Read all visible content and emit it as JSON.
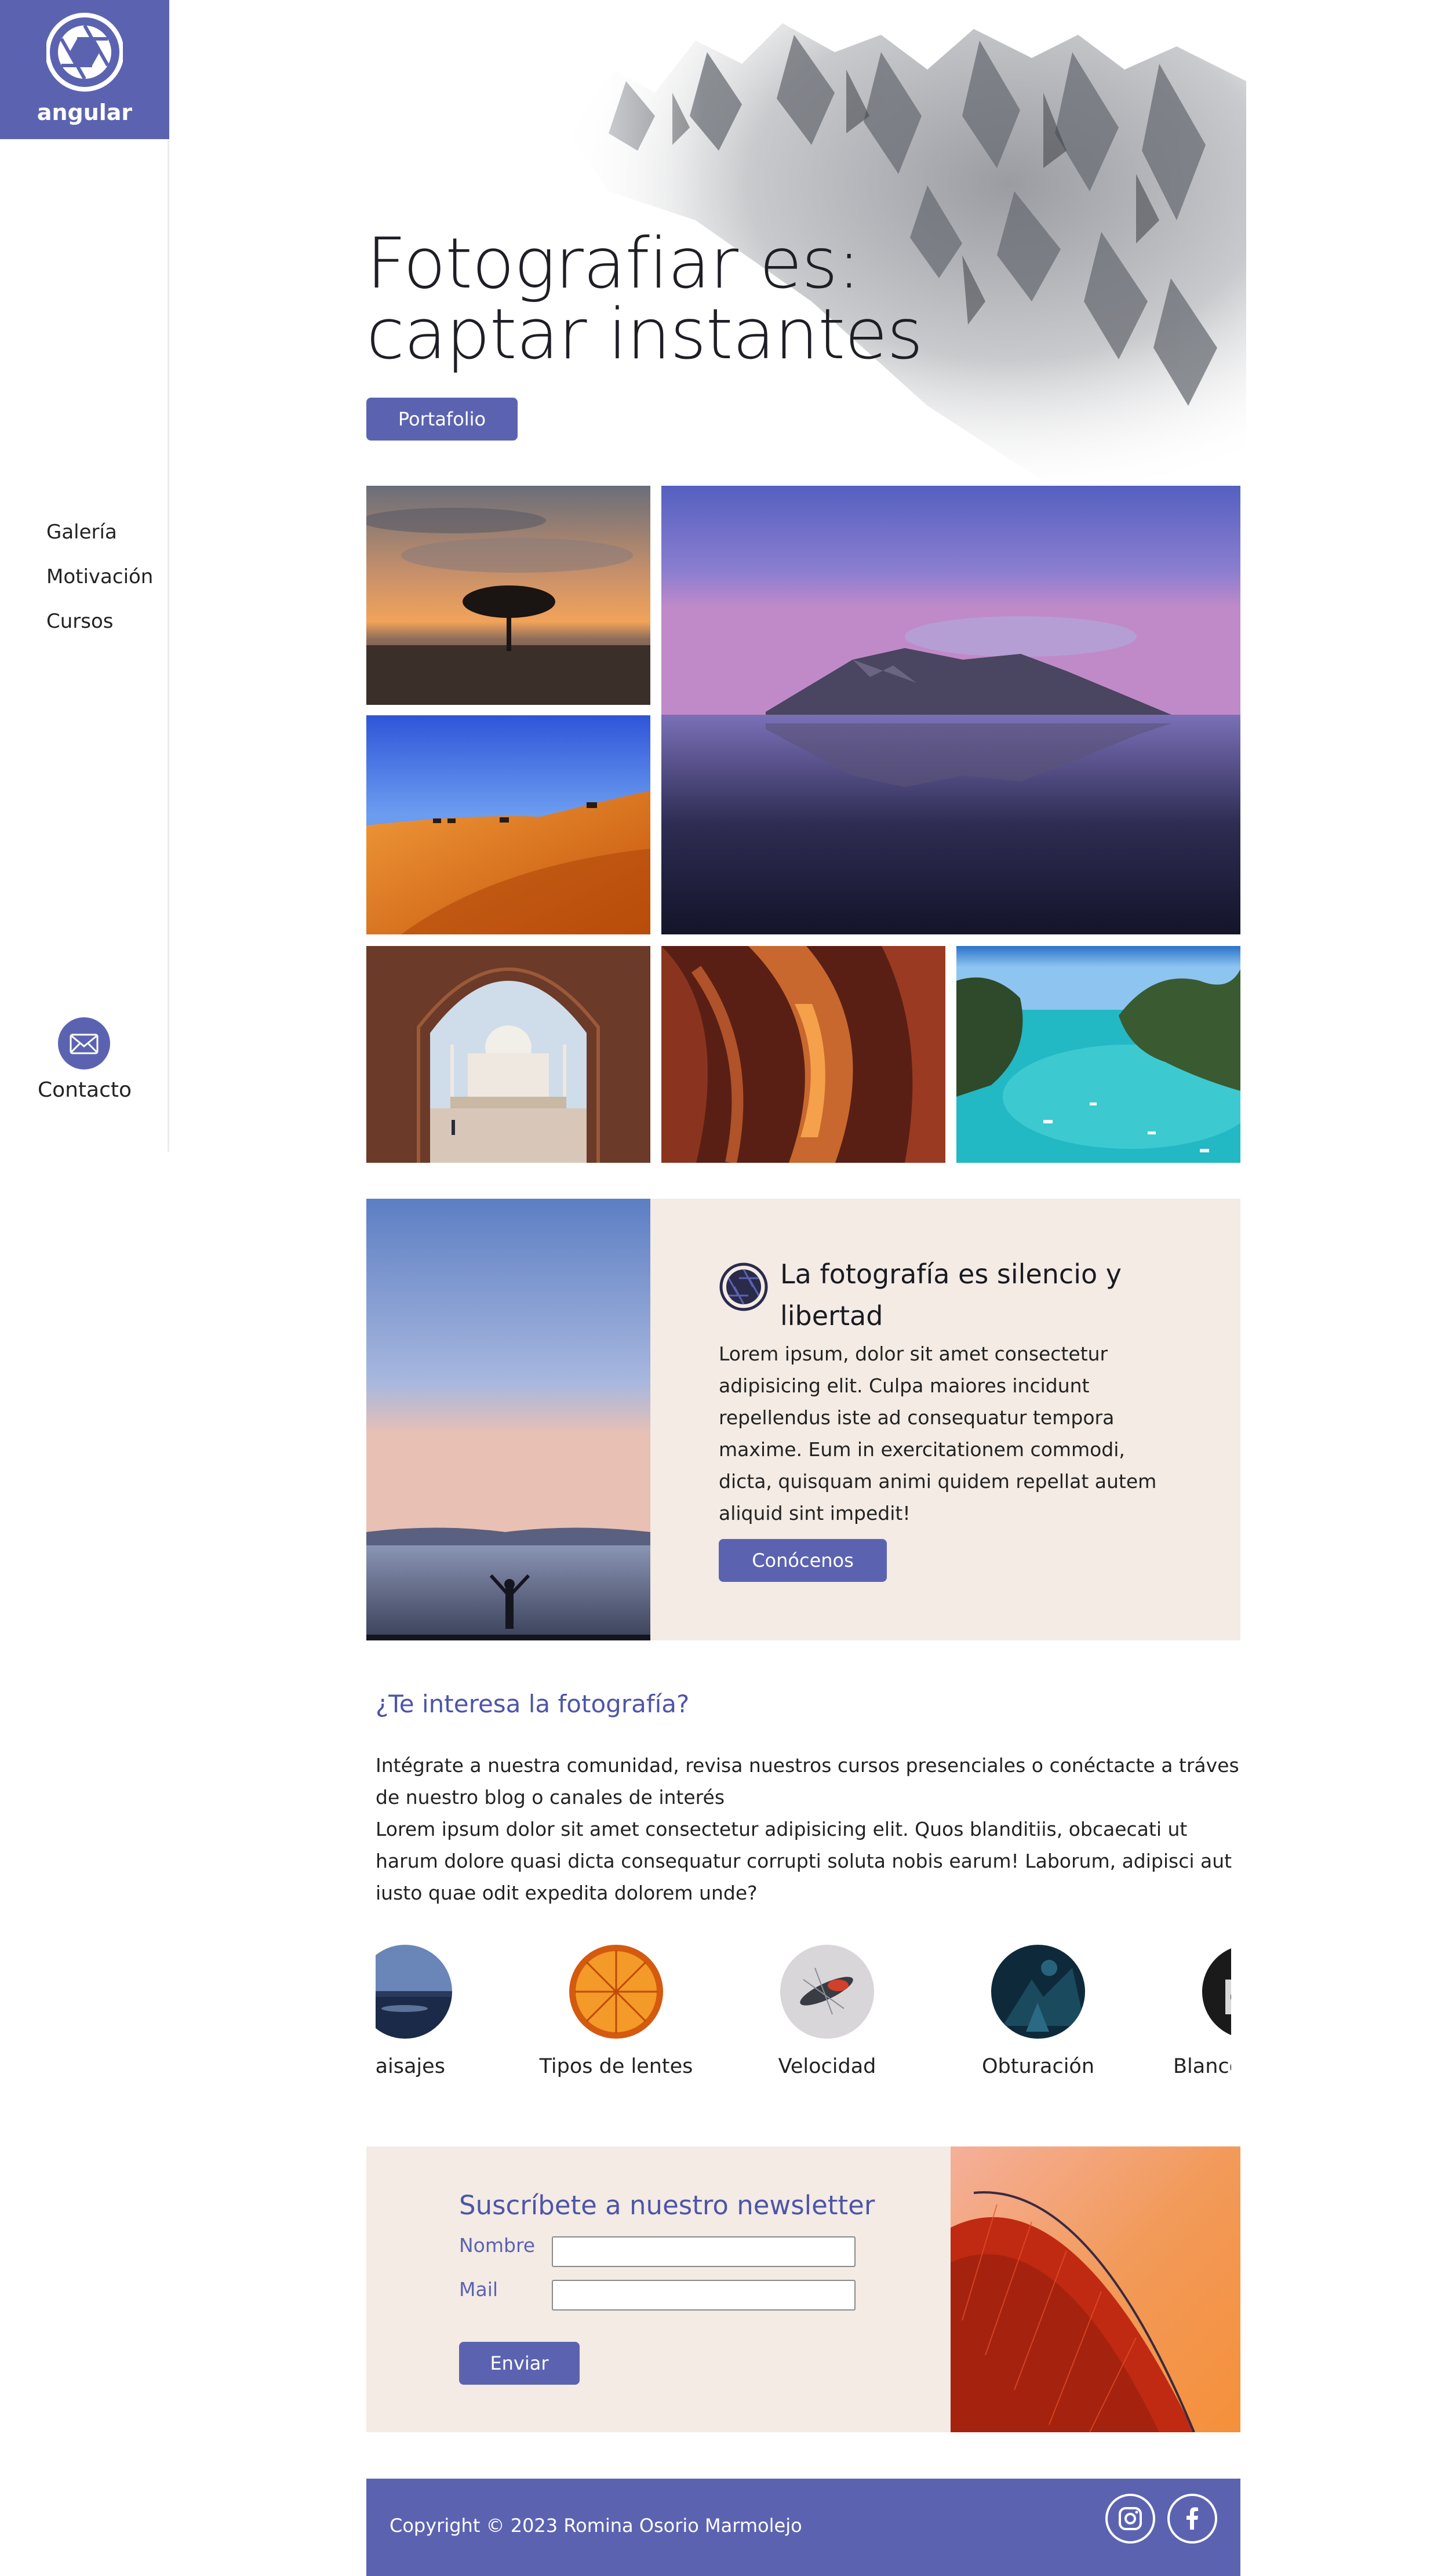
{
  "sidebar": {
    "logo_text": "angular",
    "nav": [
      {
        "label": "Galería"
      },
      {
        "label": "Motivación"
      },
      {
        "label": "Cursos"
      }
    ],
    "contact_label": "Contacto"
  },
  "hero": {
    "title_line1": "Fotografiar es:",
    "title_line2": "captar instantes",
    "button_label": "Portafolio"
  },
  "about": {
    "title": "La fotografía es silencio y libertad",
    "text": "Lorem ipsum, dolor sit amet consectetur adipisicing elit. Culpa maiores incidunt repellendus iste ad consequatur tempora maxime. Eum in exercitationem commodi, dicta, quisquam animi quidem repellat autem aliquid sint impedit!",
    "button_label": "Conócenos"
  },
  "interest": {
    "title": "¿Te interesa la fotografía?",
    "paragraph1": "Intégrate a nuestra comunidad, revisa nuestros cursos presenciales o conéctacte a tráves de nuestro blog o canales de interés",
    "paragraph2": "Lorem ipsum dolor sit amet consectetur adipisicing elit. Quos blanditiis, obcaecati ut harum dolore quasi dicta consequatur corrupti soluta nobis earum! Laborum, adipisci aut iusto quae odit expedita dolorem unde?"
  },
  "courses": [
    {
      "label": "Paisajes"
    },
    {
      "label": "Tipos de lentes"
    },
    {
      "label": "Velocidad"
    },
    {
      "label": "Obturación"
    },
    {
      "label": "Blanco y negro"
    }
  ],
  "newsletter": {
    "title": "Suscríbete a nuestro newsletter",
    "name_label": "Nombre",
    "mail_label": "Mail",
    "name_value": "",
    "mail_value": "",
    "button_label": "Enviar"
  },
  "footer": {
    "copyright": "Copyright © 2023 Romina Osorio Marmolejo",
    "icons": [
      "instagram-icon",
      "facebook-icon"
    ]
  },
  "colors": {
    "accent": "#5b63b1",
    "beige": "#f3ebe4",
    "heading_blue": "#4d55a8"
  }
}
